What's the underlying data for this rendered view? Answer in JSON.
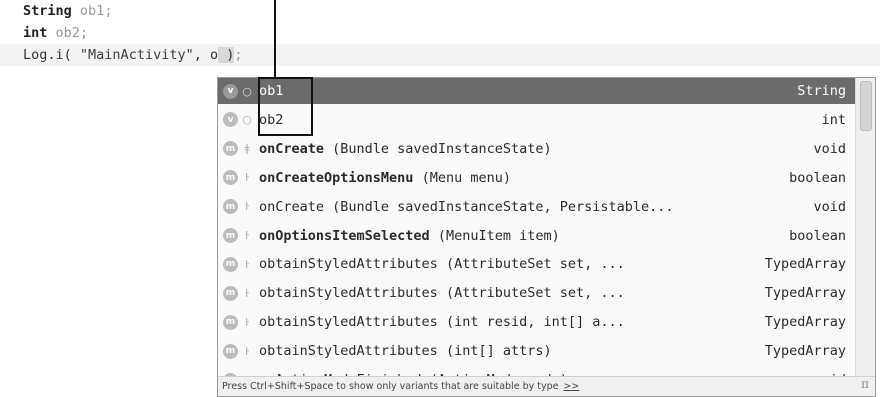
{
  "editor": {
    "line1": {
      "type": "String",
      "var": "ob1",
      "end": ";"
    },
    "line2": {
      "type": "int",
      "var": "ob2",
      "end": ";"
    },
    "line3": {
      "call": "Log.",
      "method": "i",
      "open": "( ",
      "arg1": "\"MainActivity\"",
      "sep": ", ",
      "typed": "o",
      "close": " )",
      "end": ";"
    }
  },
  "popup": {
    "items": [
      {
        "kind": "v",
        "vis": "○",
        "name": "ob1",
        "bold": "",
        "params": "",
        "type": "String",
        "selected": true
      },
      {
        "kind": "v",
        "vis": "○",
        "name": "ob2",
        "bold": "",
        "params": "",
        "type": "int"
      },
      {
        "kind": "m",
        "vis": "ǂ",
        "name": "",
        "bold": "onCreate",
        "params": " (Bundle savedInstanceState)",
        "type": "void"
      },
      {
        "kind": "m",
        "vis": "ŀ",
        "name": "",
        "bold": "onCreateOptionsMenu",
        "params": " (Menu menu)",
        "type": "boolean"
      },
      {
        "kind": "m",
        "vis": "ŀ",
        "name": "onCreate",
        "bold": "",
        "params": " (Bundle savedInstanceState, Persistable...",
        "type": "void"
      },
      {
        "kind": "m",
        "vis": "ŀ",
        "name": "",
        "bold": "onOptionsItemSelected",
        "params": " (MenuItem item)",
        "type": "boolean"
      },
      {
        "kind": "m",
        "vis": "ŀ",
        "name": "obtainStyledAttributes",
        "bold": "",
        "params": " (AttributeSet set, ...",
        "type": "TypedArray"
      },
      {
        "kind": "m",
        "vis": "ŀ",
        "name": "obtainStyledAttributes",
        "bold": "",
        "params": " (AttributeSet set, ...",
        "type": "TypedArray"
      },
      {
        "kind": "m",
        "vis": "ŀ",
        "name": "obtainStyledAttributes",
        "bold": "",
        "params": " (int resid, int[] a...",
        "type": "TypedArray"
      },
      {
        "kind": "m",
        "vis": "ŀ",
        "name": "obtainStyledAttributes",
        "bold": "",
        "params": " (int[] attrs)",
        "type": "TypedArray"
      },
      {
        "kind": "m",
        "vis": "ŀ",
        "name": "onActionModeFinished",
        "bold": "",
        "params": " (ActionMode mode)",
        "type": "void"
      }
    ],
    "hint": "Press Ctrl+Shift+Space to show only variants that are suitable by type",
    "hint_link": ">>",
    "pi_icon": "π"
  }
}
